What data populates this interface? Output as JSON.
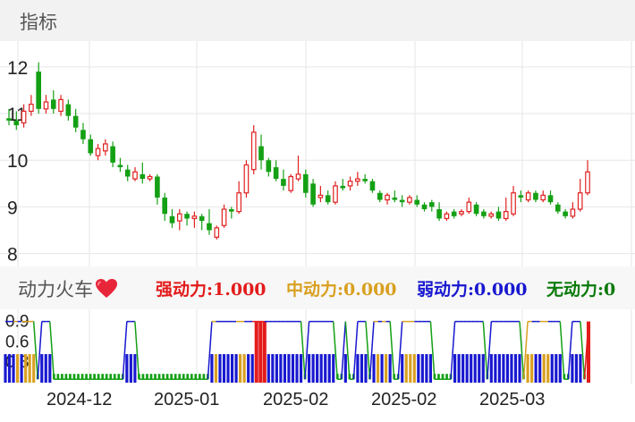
{
  "header": {
    "title": "指标"
  },
  "indicator": {
    "name": "动力火车",
    "legend": [
      {
        "label": "强动力:1.000",
        "color": "#e31b1b"
      },
      {
        "label": "中动力:0.000",
        "color": "#d9a020"
      },
      {
        "label": "弱动力:0.000",
        "color": "#1818d0"
      },
      {
        "label": "无动力:0",
        "color": "#0a7a0a"
      }
    ]
  },
  "colors": {
    "up": "#e02020",
    "down": "#14a014",
    "grid": "#e6e6e6"
  },
  "chart_data": [
    {
      "type": "candlestick",
      "y_ticks": [
        "12",
        "11",
        "10",
        "9",
        "8"
      ],
      "y_tick_values": [
        12,
        11,
        10,
        9,
        8
      ],
      "ylim": [
        7.8,
        12.4
      ],
      "x_labels": [
        "2024-12",
        "2025-01",
        "2025-02",
        "2025-02",
        "2025-03"
      ],
      "candles": [
        [
          10.9,
          10.85,
          11.1,
          10.75
        ],
        [
          10.85,
          10.75,
          11.05,
          10.65
        ],
        [
          10.8,
          11.05,
          11.2,
          10.7
        ],
        [
          11.05,
          11.2,
          11.4,
          10.95
        ],
        [
          11.9,
          11.1,
          12.1,
          11.0
        ],
        [
          11.1,
          11.25,
          11.4,
          11.0
        ],
        [
          11.3,
          11.1,
          11.5,
          11.0
        ],
        [
          11.05,
          11.3,
          11.4,
          10.95
        ],
        [
          11.2,
          10.95,
          11.3,
          10.85
        ],
        [
          10.95,
          10.7,
          11.1,
          10.6
        ],
        [
          10.65,
          10.45,
          10.8,
          10.35
        ],
        [
          10.45,
          10.15,
          10.55,
          10.1
        ],
        [
          10.1,
          10.25,
          10.35,
          10.0
        ],
        [
          10.2,
          10.35,
          10.45,
          10.1
        ],
        [
          10.3,
          9.95,
          10.4,
          9.85
        ],
        [
          9.9,
          9.85,
          10.05,
          9.75
        ],
        [
          9.8,
          9.65,
          9.9,
          9.55
        ],
        [
          9.6,
          9.75,
          9.85,
          9.55
        ],
        [
          9.7,
          9.6,
          9.95,
          9.5
        ],
        [
          9.6,
          9.65,
          9.7,
          9.55
        ],
        [
          9.65,
          9.2,
          9.7,
          9.05
        ],
        [
          9.2,
          8.85,
          9.3,
          8.7
        ],
        [
          8.8,
          8.65,
          8.95,
          8.55
        ],
        [
          8.7,
          8.85,
          8.95,
          8.5
        ],
        [
          8.85,
          8.75,
          8.9,
          8.6
        ],
        [
          8.75,
          8.8,
          8.9,
          8.55
        ],
        [
          8.8,
          8.7,
          8.85,
          8.5
        ],
        [
          8.65,
          8.5,
          8.95,
          8.4
        ],
        [
          8.35,
          8.55,
          8.6,
          8.3
        ],
        [
          8.6,
          8.95,
          9.05,
          8.55
        ],
        [
          8.95,
          8.9,
          9.0,
          8.75
        ],
        [
          8.9,
          9.3,
          9.55,
          8.85
        ],
        [
          9.3,
          9.9,
          10.0,
          9.2
        ],
        [
          9.8,
          10.6,
          10.75,
          9.7
        ],
        [
          10.3,
          10.0,
          10.55,
          9.8
        ],
        [
          10.0,
          9.75,
          10.05,
          9.65
        ],
        [
          9.85,
          9.6,
          10.0,
          9.55
        ],
        [
          9.6,
          9.45,
          9.8,
          9.35
        ],
        [
          9.35,
          9.65,
          9.7,
          9.3
        ],
        [
          9.6,
          9.7,
          10.1,
          9.55
        ],
        [
          9.7,
          9.3,
          9.8,
          9.2
        ],
        [
          9.5,
          9.05,
          9.6,
          9.0
        ],
        [
          9.2,
          9.25,
          9.45,
          9.1
        ],
        [
          9.25,
          9.1,
          9.35,
          9.05
        ],
        [
          9.1,
          9.45,
          9.55,
          9.05
        ],
        [
          9.45,
          9.4,
          9.6,
          9.35
        ],
        [
          9.45,
          9.55,
          9.65,
          9.35
        ],
        [
          9.55,
          9.6,
          9.75,
          9.45
        ],
        [
          9.6,
          9.55,
          9.7,
          9.5
        ],
        [
          9.55,
          9.35,
          9.6,
          9.3
        ],
        [
          9.3,
          9.15,
          9.35,
          9.1
        ],
        [
          9.15,
          9.25,
          9.3,
          9.05
        ],
        [
          9.2,
          9.15,
          9.35,
          9.1
        ],
        [
          9.15,
          9.1,
          9.25,
          9.0
        ],
        [
          9.1,
          9.2,
          9.25,
          9.05
        ],
        [
          9.15,
          9.05,
          9.25,
          9.0
        ],
        [
          9.05,
          8.95,
          9.1,
          8.9
        ],
        [
          9.1,
          9.0,
          9.15,
          8.9
        ],
        [
          8.95,
          8.75,
          9.1,
          8.7
        ],
        [
          8.75,
          8.85,
          8.9,
          8.7
        ],
        [
          8.9,
          8.8,
          8.95,
          8.75
        ],
        [
          8.85,
          8.9,
          8.95,
          8.8
        ],
        [
          8.9,
          9.1,
          9.2,
          8.85
        ],
        [
          9.05,
          8.85,
          9.1,
          8.8
        ],
        [
          8.9,
          8.8,
          8.95,
          8.75
        ],
        [
          8.8,
          8.85,
          8.9,
          8.75
        ],
        [
          8.9,
          8.75,
          9.0,
          8.7
        ],
        [
          8.75,
          8.9,
          9.2,
          8.7
        ],
        [
          8.85,
          9.3,
          9.45,
          8.8
        ],
        [
          9.25,
          9.2,
          9.35,
          9.1
        ],
        [
          9.15,
          9.3,
          9.35,
          9.1
        ],
        [
          9.3,
          9.15,
          9.35,
          9.1
        ],
        [
          9.15,
          9.25,
          9.35,
          9.1
        ],
        [
          9.25,
          9.1,
          9.35,
          9.05
        ],
        [
          9.05,
          8.9,
          9.1,
          8.85
        ],
        [
          8.9,
          8.8,
          8.95,
          8.75
        ],
        [
          8.8,
          8.95,
          9.1,
          8.75
        ],
        [
          8.95,
          9.3,
          9.6,
          8.9
        ],
        [
          9.3,
          9.75,
          10.0,
          9.25
        ]
      ]
    },
    {
      "type": "step-area",
      "y_ticks": [
        "0.9",
        "0.6",
        "0.3"
      ],
      "y_tick_values": [
        0.9,
        0.6,
        0.3
      ],
      "ylim": [
        0,
        1.0
      ],
      "series": [
        {
          "name": "强动力",
          "color": "#e31b1b"
        },
        {
          "name": "中动力",
          "color": "#d9a020"
        },
        {
          "name": "弱动力",
          "color": "#1818d0"
        },
        {
          "name": "无动力",
          "color": "#0a7a0a"
        }
      ],
      "states": [
        2,
        2,
        2,
        1,
        2,
        1,
        1,
        1,
        0,
        2,
        2,
        2,
        0,
        0,
        0,
        0,
        0,
        0,
        0,
        0,
        0,
        0,
        0,
        0,
        0,
        0,
        0,
        0,
        0,
        0,
        2,
        2,
        2,
        0,
        0,
        0,
        0,
        0,
        0,
        0,
        0,
        0,
        0,
        0,
        0,
        0,
        0,
        0,
        0,
        0,
        0,
        2,
        1,
        2,
        2,
        2,
        2,
        2,
        1,
        1,
        2,
        2,
        3,
        3,
        3,
        2,
        2,
        2,
        2,
        2,
        2,
        2,
        2,
        2,
        0,
        2,
        2,
        2,
        2,
        2,
        2,
        2,
        0,
        0,
        2,
        0,
        0,
        2,
        2,
        2,
        0,
        2,
        1,
        2,
        1,
        2,
        0,
        0,
        2,
        1,
        1,
        1,
        2,
        2,
        2,
        2,
        0,
        0,
        0,
        0,
        0,
        2,
        2,
        2,
        2,
        2,
        2,
        2,
        2,
        0,
        2,
        2,
        2,
        2,
        2,
        2,
        2,
        2,
        0,
        1,
        1,
        2,
        2,
        1,
        1,
        2,
        2,
        2,
        0,
        0,
        2,
        2,
        2,
        0,
        3
      ]
    }
  ]
}
